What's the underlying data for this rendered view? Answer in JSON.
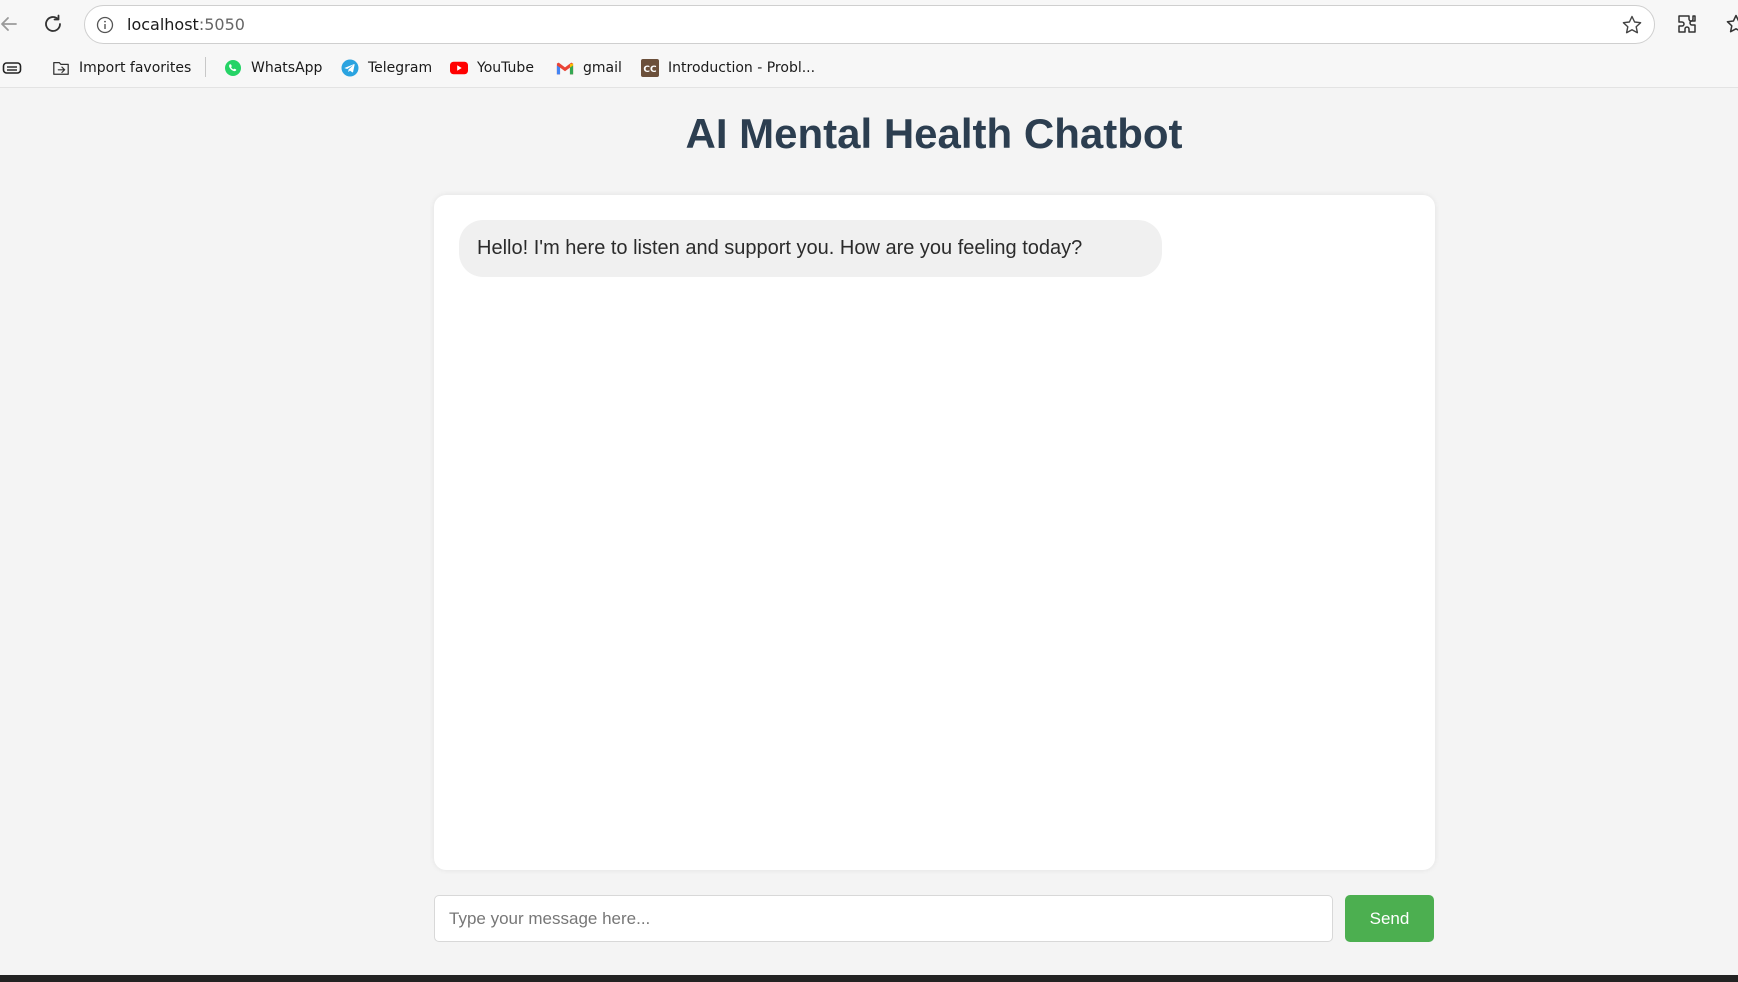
{
  "browser": {
    "url_host": "localhost",
    "url_port": ":5050",
    "icons": {
      "back": "back-arrow-icon",
      "reload": "reload-icon",
      "info": "info-icon",
      "star": "star-icon",
      "extensions": "extensions-icon",
      "favorites": "favorites-icon"
    }
  },
  "bookmarks": [
    {
      "label": "Import favorites",
      "icon": "import-icon"
    },
    {
      "label": "WhatsApp",
      "icon": "whatsapp-icon",
      "color": "#25d366"
    },
    {
      "label": "Telegram",
      "icon": "telegram-icon",
      "color": "#2aa3e0"
    },
    {
      "label": "YouTube",
      "icon": "youtube-icon",
      "color": "#ff0000"
    },
    {
      "label": "gmail",
      "icon": "gmail-icon",
      "color": "#ea4335"
    },
    {
      "label": "Introduction - Probl...",
      "icon": "cc-icon",
      "color": "#6b4f3a"
    }
  ],
  "page": {
    "title": "AI Mental Health Chatbot",
    "messages": [
      {
        "sender": "bot",
        "text": "Hello! I'm here to listen and support you. How are you feeling today?"
      }
    ],
    "input_placeholder": "Type your message here...",
    "input_value": "",
    "send_label": "Send"
  },
  "colors": {
    "title": "#2c3e50",
    "send_button": "#4caf50",
    "bot_bubble": "#f0f0f0",
    "background": "#f4f4f4"
  }
}
